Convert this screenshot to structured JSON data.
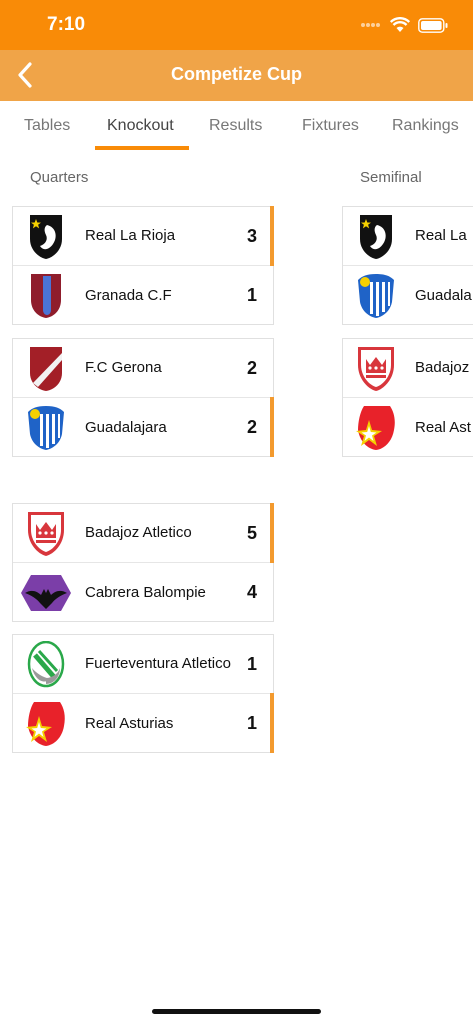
{
  "status": {
    "time": "7:10"
  },
  "header": {
    "title": "Competize Cup"
  },
  "tabs": [
    {
      "label": "Tables"
    },
    {
      "label": "Knockout"
    },
    {
      "label": "Results"
    },
    {
      "label": "Fixtures"
    },
    {
      "label": "Rankings"
    }
  ],
  "rounds": [
    {
      "label": "Quarters"
    },
    {
      "label": "Semifinal"
    }
  ],
  "quarters": [
    {
      "home": {
        "name": "Real La Rioja",
        "score": "3",
        "crest": "black-white-shield-with-star"
      },
      "away": {
        "name": "Granada C.F",
        "score": "1",
        "crest": "maroon-blue-shield"
      }
    },
    {
      "home": {
        "name": "F.C Gerona",
        "score": "2",
        "crest": "red-white-sash-shield"
      },
      "away": {
        "name": "Guadalajara",
        "score": "2",
        "crest": "blue-white-striped-shield"
      }
    },
    {
      "home": {
        "name": "Badajoz Atletico",
        "score": "5",
        "crest": "red-crown-shield"
      },
      "away": {
        "name": "Cabrera Balompie",
        "score": "4",
        "crest": "purple-bat-hexagon"
      }
    },
    {
      "home": {
        "name": "Fuerteventura Atletico",
        "score": "1",
        "crest": "green-stripe-ball"
      },
      "away": {
        "name": "Real Asturias",
        "score": "1",
        "crest": "red-yellow-star-shield"
      }
    }
  ],
  "semifinals": [
    {
      "home": {
        "name": "Real La",
        "crest": "black-white-shield-with-star"
      },
      "away": {
        "name": "Guadala",
        "crest": "blue-white-striped-shield"
      }
    },
    {
      "home": {
        "name": "Badajoz",
        "crest": "red-crown-shield"
      },
      "away": {
        "name": "Real Ast",
        "crest": "red-yellow-star-shield"
      }
    }
  ],
  "colors": {
    "accent": "#f98b07",
    "header": "#f0a448",
    "winner_bar": "#f39a2e"
  }
}
